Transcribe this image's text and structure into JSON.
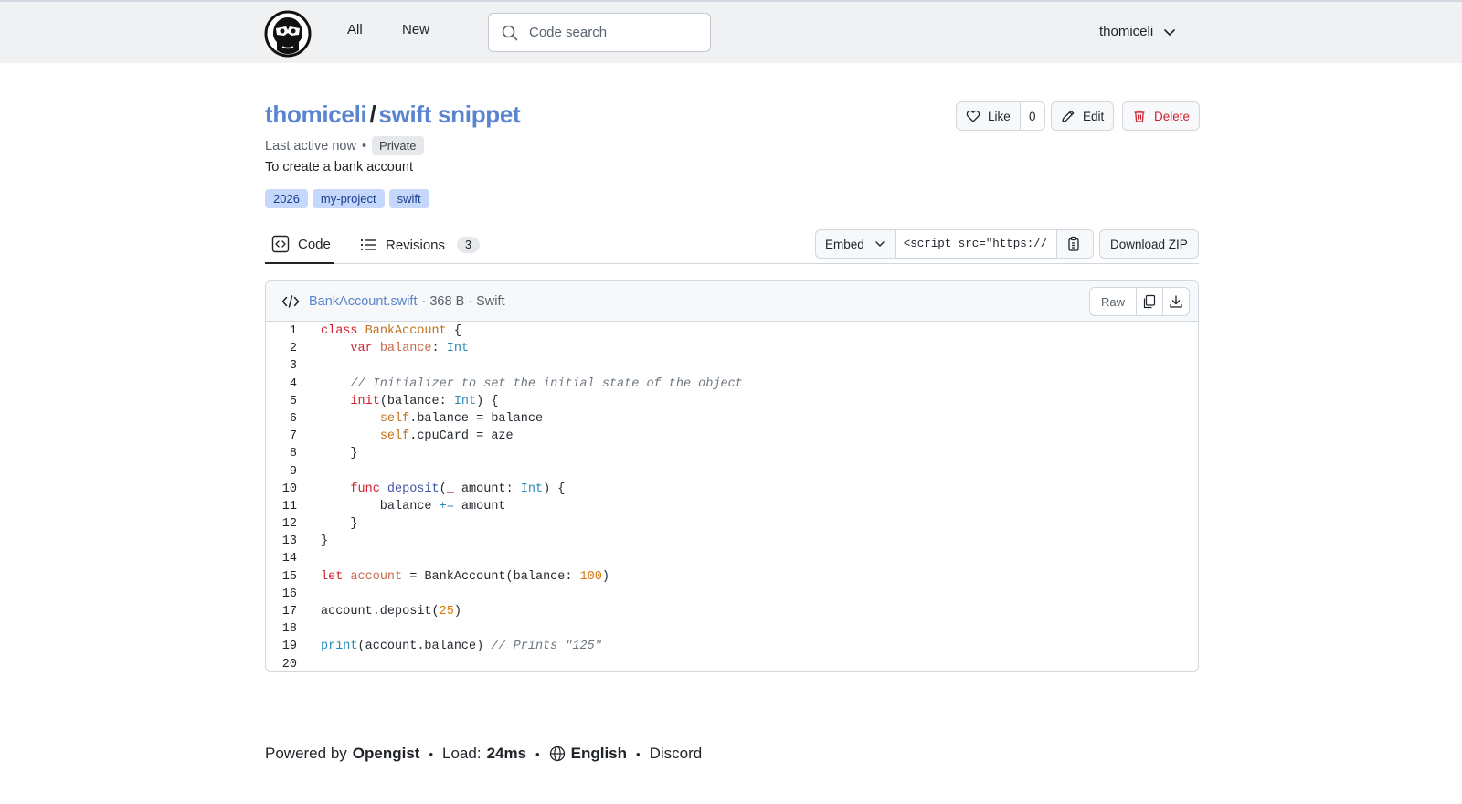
{
  "nav": {
    "all": "All",
    "new": "New",
    "search_placeholder": "Code search",
    "username": "thomiceli"
  },
  "gist": {
    "owner": "thomiceli",
    "separator": "/",
    "title": "swift snippet",
    "last_active": "Last active now",
    "bullet": "•",
    "visibility": "Private",
    "description": "To create a bank account",
    "topics": [
      "2026",
      "my-project",
      "swift"
    ]
  },
  "actions": {
    "like": "Like",
    "like_count": "0",
    "edit": "Edit",
    "delete": "Delete"
  },
  "tabs": {
    "code": "Code",
    "revisions": "Revisions",
    "revisions_count": "3"
  },
  "embed": {
    "label": "Embed",
    "value": "<script src=\"https://",
    "download": "Download ZIP"
  },
  "file": {
    "name": "BankAccount.swift",
    "meta": "· 368 B · Swift",
    "raw": "Raw",
    "lines": [
      "1",
      "2",
      "3",
      "4",
      "5",
      "6",
      "7",
      "8",
      "9",
      "10",
      "11",
      "12",
      "13",
      "14",
      "15",
      "16",
      "17",
      "18",
      "19",
      "20"
    ]
  },
  "footer": {
    "powered_by": "Powered by",
    "brand": "Opengist",
    "load_label": "Load:",
    "load_value": "24ms",
    "language": "English",
    "discord": "Discord"
  },
  "colors": {
    "accent": "#5a84cf",
    "danger": "#cf222e",
    "topic_bg": "#c5d7fb"
  }
}
